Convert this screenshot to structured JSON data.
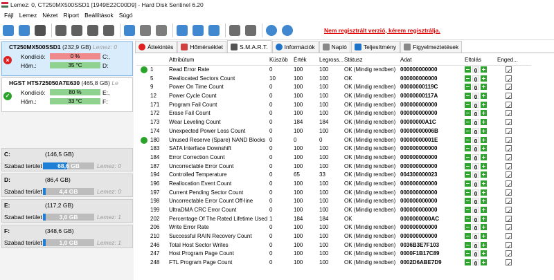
{
  "window": {
    "title": "Lemez: 0, CT250MX500SSD1 [1949E22C00D9]  -  Hard Disk Sentinel 6.20"
  },
  "menu": [
    "Fájl",
    "Lemez",
    "Nézet",
    "Riport",
    "Beállítások",
    "Súgó"
  ],
  "toolbar": {
    "icons": [
      "refresh-icon",
      "refresh-all-icon",
      "list-icon",
      "disk-icon",
      "disk-clock-icon",
      "disk-check-icon",
      "disk-search-icon",
      "globe-disk-icon",
      "network-icon",
      "drive-icon",
      "notepad-icon",
      "mail-icon",
      "mail-open-icon",
      "gear-icon",
      "speaker-icon",
      "help-icon",
      "info-icon"
    ],
    "register_text": "Nem regisztrált verzió, kérem regisztrálja."
  },
  "disks": [
    {
      "model": "CT250MX500SSD1",
      "capacity": "(232,9 GB)",
      "label": "Lemez: 0",
      "health_label": "Kondíció:",
      "health": "0 %",
      "health_pct": 0,
      "temp_label": "Hőm.:",
      "temp": "35 °C",
      "letters1": "C:,",
      "letters2": "D:",
      "status": "bad"
    },
    {
      "model": "HGST HTS725050A7E630",
      "capacity": "(465,8 GB)",
      "label": "Le",
      "health_label": "Kondíció:",
      "health": "80 %",
      "health_pct": 80,
      "temp_label": "Hőm.:",
      "temp": "33 °C",
      "letters1": "E:,",
      "letters2": "F:",
      "status": "ok"
    }
  ],
  "volumes": [
    {
      "letter": "C:",
      "capacity": "(146,5 GB)",
      "free_label": "Szabad terület",
      "free": "68,6 GB",
      "free_pct": 47,
      "disk": "Lemez: 0"
    },
    {
      "letter": "D:",
      "capacity": "(86,4 GB)",
      "free_label": "Szabad terület",
      "free": "4,4 GB",
      "free_pct": 5,
      "disk": "Lemez: 0"
    },
    {
      "letter": "E:",
      "capacity": "(117,2 GB)",
      "free_label": "Szabad terület",
      "free": "3,0 GB",
      "free_pct": 3,
      "disk": "Lemez: 1"
    },
    {
      "letter": "F:",
      "capacity": "(348,6 GB)",
      "free_label": "Szabad terület",
      "free": "1,0 GB",
      "free_pct": 1,
      "disk": "Lemez: 1"
    }
  ],
  "tabs": [
    {
      "label": "Áttekintés",
      "icon": "error-icon",
      "color": "#e02020"
    },
    {
      "label": "Hőmérséklet",
      "icon": "thermometer-icon",
      "color": "#d04040"
    },
    {
      "label": "S.M.A.R.T.",
      "icon": "smart-icon",
      "color": "#555555",
      "active": true
    },
    {
      "label": "Információk",
      "icon": "info-icon",
      "color": "#1e73c8"
    },
    {
      "label": "Napló",
      "icon": "log-icon",
      "color": "#888888"
    },
    {
      "label": "Teljesítmény",
      "icon": "performance-icon",
      "color": "#1e73c8"
    },
    {
      "label": "Figyelmeztetések",
      "icon": "alerts-icon",
      "color": "#888888"
    }
  ],
  "smart": {
    "headers": {
      "id": "",
      "attr": "Attribútum",
      "thr": "Küszöb",
      "val": "Érték",
      "worst": "Legross...",
      "status": "Státusz",
      "data": "Adat",
      "lock": "Eltolás",
      "enable": "Enged..."
    },
    "rows": [
      {
        "id": "1",
        "attr": "Read Error Rate",
        "thr": "0",
        "val": "100",
        "worst": "100",
        "status": "OK (Mindig rendben)",
        "data": "000000000000",
        "icon": true
      },
      {
        "id": "5",
        "attr": "Reallocated Sectors Count",
        "thr": "10",
        "val": "100",
        "worst": "100",
        "status": "OK",
        "data": "000000000000"
      },
      {
        "id": "9",
        "attr": "Power On Time Count",
        "thr": "0",
        "val": "100",
        "worst": "100",
        "status": "OK (Mindig rendben)",
        "data": "00000000119C"
      },
      {
        "id": "12",
        "attr": "Power Cycle Count",
        "thr": "0",
        "val": "100",
        "worst": "100",
        "status": "OK (Mindig rendben)",
        "data": "00000000117A"
      },
      {
        "id": "171",
        "attr": "Program Fail Count",
        "thr": "0",
        "val": "100",
        "worst": "100",
        "status": "OK (Mindig rendben)",
        "data": "000000000000"
      },
      {
        "id": "172",
        "attr": "Erase Fail Count",
        "thr": "0",
        "val": "100",
        "worst": "100",
        "status": "OK (Mindig rendben)",
        "data": "000000000000"
      },
      {
        "id": "173",
        "attr": "Wear Leveling Count",
        "thr": "0",
        "val": "184",
        "worst": "184",
        "status": "OK (Mindig rendben)",
        "data": "00000000A1C"
      },
      {
        "id": "174",
        "attr": "Unexpected Power Loss Count",
        "thr": "0",
        "val": "100",
        "worst": "100",
        "status": "OK (Mindig rendben)",
        "data": "00000000006B"
      },
      {
        "id": "180",
        "attr": "Unused Reserve (Spare) NAND Blocks",
        "thr": "0",
        "val": "0",
        "worst": "0",
        "status": "OK (Mindig rendben)",
        "data": "00000000001E",
        "icon": true
      },
      {
        "id": "183",
        "attr": "SATA Interface Downshift",
        "thr": "0",
        "val": "100",
        "worst": "100",
        "status": "OK (Mindig rendben)",
        "data": "000000000000"
      },
      {
        "id": "184",
        "attr": "Error Correction Count",
        "thr": "0",
        "val": "100",
        "worst": "100",
        "status": "OK (Mindig rendben)",
        "data": "000000000000"
      },
      {
        "id": "187",
        "attr": "Uncorrectable Error Count",
        "thr": "0",
        "val": "100",
        "worst": "100",
        "status": "OK (Mindig rendben)",
        "data": "000000000000"
      },
      {
        "id": "194",
        "attr": "Controlled Temperature",
        "thr": "0",
        "val": "65",
        "worst": "33",
        "status": "OK (Mindig rendben)",
        "data": "004300000023"
      },
      {
        "id": "196",
        "attr": "Reallocation Event Count",
        "thr": "0",
        "val": "100",
        "worst": "100",
        "status": "OK (Mindig rendben)",
        "data": "000000000000"
      },
      {
        "id": "197",
        "attr": "Current Pending Sector Count",
        "thr": "0",
        "val": "100",
        "worst": "100",
        "status": "OK (Mindig rendben)",
        "data": "000000000000"
      },
      {
        "id": "198",
        "attr": "Uncorrectable Error Count Off-line",
        "thr": "0",
        "val": "100",
        "worst": "100",
        "status": "OK (Mindig rendben)",
        "data": "000000000000"
      },
      {
        "id": "199",
        "attr": "UltraDMA CRC Error Count",
        "thr": "0",
        "val": "100",
        "worst": "100",
        "status": "OK (Mindig rendben)",
        "data": "000000000000"
      },
      {
        "id": "202",
        "attr": "Percentage Of The Rated Lifetime Used",
        "thr": "1",
        "val": "184",
        "worst": "184",
        "status": "OK",
        "data": "0000000000AC"
      },
      {
        "id": "206",
        "attr": "Write Error Rate",
        "thr": "0",
        "val": "100",
        "worst": "100",
        "status": "OK (Mindig rendben)",
        "data": "000000000000"
      },
      {
        "id": "210",
        "attr": "Successful RAIN Recovery Count",
        "thr": "0",
        "val": "100",
        "worst": "100",
        "status": "OK (Mindig rendben)",
        "data": "000000000000"
      },
      {
        "id": "246",
        "attr": "Total Host Sector Writes",
        "thr": "0",
        "val": "100",
        "worst": "100",
        "status": "OK (Mindig rendben)",
        "data": "0036B3E7F103"
      },
      {
        "id": "247",
        "attr": "Host Program Page Count",
        "thr": "0",
        "val": "100",
        "worst": "100",
        "status": "OK (Mindig rendben)",
        "data": "0000F1B17C89"
      },
      {
        "id": "248",
        "attr": "FTL Program Page Count",
        "thr": "0",
        "val": "100",
        "worst": "100",
        "status": "OK (Mindig rendben)",
        "data": "0002D6ABE7D9"
      }
    ],
    "offset_value": "0",
    "check_glyph": "✓"
  }
}
